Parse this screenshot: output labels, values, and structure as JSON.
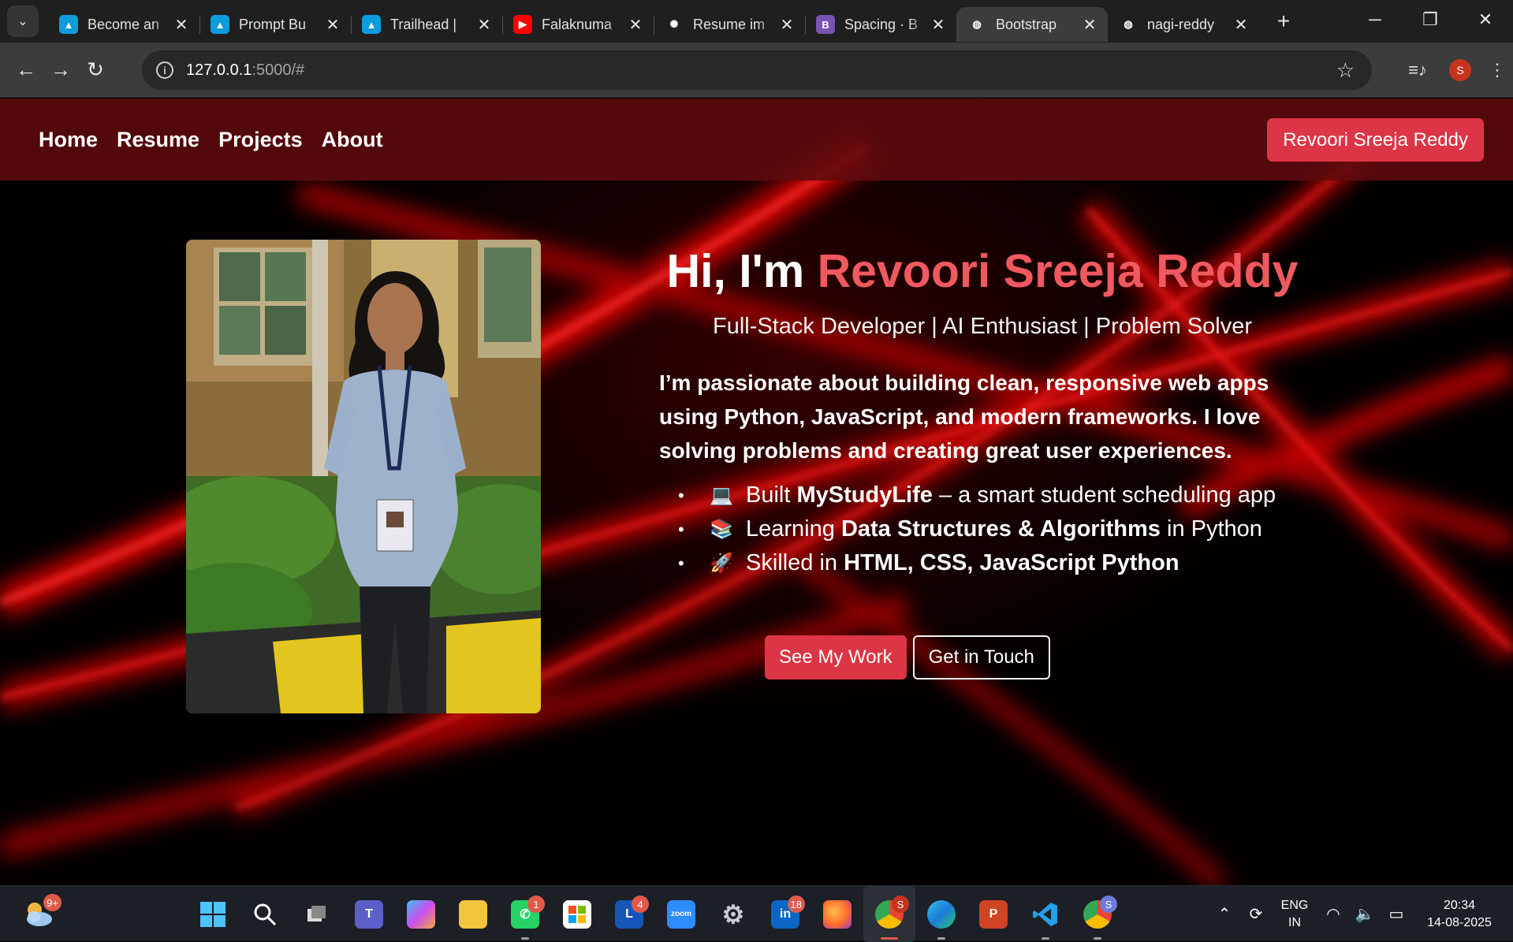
{
  "browser": {
    "tabs": [
      {
        "title": "Become an",
        "favicon": "trailhead-icon",
        "color": "#0d9dda",
        "active": false
      },
      {
        "title": "Prompt Bu",
        "favicon": "trailhead-icon",
        "color": "#0d9dda",
        "active": false
      },
      {
        "title": "Trailhead |",
        "favicon": "trailhead-icon",
        "color": "#0d9dda",
        "active": false
      },
      {
        "title": "Falaknuma",
        "favicon": "youtube-icon",
        "color": "#ff0000",
        "active": false
      },
      {
        "title": "Resume im",
        "favicon": "chatgpt-icon",
        "color": "#1f1f1f",
        "active": false
      },
      {
        "title": "Spacing · B",
        "favicon": "bootstrap-icon",
        "color": "#7952b3",
        "active": false
      },
      {
        "title": "Bootstrap",
        "favicon": "globe-icon",
        "color": "#3c3c3c",
        "active": true
      },
      {
        "title": "nagi-reddy",
        "favicon": "globe-icon",
        "color": "#1f1f1f",
        "active": false
      }
    ],
    "url_host": "127.0.0.1",
    "url_rest": ":5000/#",
    "profile_initial": "S"
  },
  "site": {
    "nav": [
      "Home",
      "Resume",
      "Projects",
      "About"
    ],
    "brand": "Revoori Sreeja Reddy",
    "hero": {
      "greeting": "Hi, I'm ",
      "name": "Revoori Sreeja Reddy",
      "subtitle": "Full-Stack Developer | AI Enthusiast | Problem Solver",
      "bio": "I’m passionate about building clean, responsive web apps using Python, JavaScript, and modern frameworks. I love solving problems and creating great user experiences.",
      "highlights": [
        {
          "emoji": "💻",
          "pre": "Built ",
          "bold": "MyStudyLife",
          "post": " – a smart student scheduling app"
        },
        {
          "emoji": "📚",
          "pre": "Learning ",
          "bold": "Data Structures & Algorithms",
          "post": " in Python"
        },
        {
          "emoji": "🚀",
          "pre": "Skilled in ",
          "bold": "HTML, CSS, JavaScript Python",
          "post": ""
        }
      ],
      "primary_cta": "See My Work",
      "secondary_cta": "Get in Touch"
    },
    "accent": "#dc3545",
    "name_color": "#f0595f"
  },
  "taskbar": {
    "apps": [
      {
        "name": "start-icon",
        "label": "",
        "badge": "",
        "running": false,
        "active": false
      },
      {
        "name": "search-icon",
        "label": "",
        "badge": "",
        "running": false,
        "active": false
      },
      {
        "name": "task-view-icon",
        "label": "",
        "badge": "",
        "running": false,
        "active": false
      },
      {
        "name": "teams-icon",
        "label": "T",
        "badge": "",
        "running": false,
        "active": false
      },
      {
        "name": "copilot-icon",
        "label": "",
        "badge": "",
        "running": false,
        "active": false
      },
      {
        "name": "file-explorer-icon",
        "label": "",
        "badge": "",
        "running": false,
        "active": false
      },
      {
        "name": "whatsapp-icon",
        "label": "",
        "badge": "1",
        "running": true,
        "active": false
      },
      {
        "name": "store-icon",
        "label": "",
        "badge": "",
        "running": false,
        "active": false
      },
      {
        "name": "l-app-icon",
        "label": "L",
        "badge": "4",
        "running": false,
        "active": false
      },
      {
        "name": "zoom-icon",
        "label": "zoom",
        "badge": "",
        "running": false,
        "active": false
      },
      {
        "name": "settings-icon",
        "label": "",
        "badge": "",
        "running": false,
        "active": false
      },
      {
        "name": "linkedin-icon",
        "label": "in",
        "badge": "18",
        "running": false,
        "active": false
      },
      {
        "name": "firefox-icon",
        "label": "",
        "badge": "",
        "running": false,
        "active": false
      },
      {
        "name": "chrome-icon",
        "label": "",
        "badge": "S",
        "running": true,
        "active": true
      },
      {
        "name": "edge-icon",
        "label": "",
        "badge": "",
        "running": true,
        "active": false
      },
      {
        "name": "powerpoint-icon",
        "label": "P",
        "badge": "",
        "running": false,
        "active": false
      },
      {
        "name": "vscode-icon",
        "label": "",
        "badge": "",
        "running": true,
        "active": false
      },
      {
        "name": "chrome-profile-icon",
        "label": "",
        "badge": "S",
        "running": true,
        "active": false
      }
    ],
    "weather_badge": "9+",
    "lang_top": "ENG",
    "lang_bottom": "IN",
    "time": "20:34",
    "date": "14-08-2025"
  }
}
